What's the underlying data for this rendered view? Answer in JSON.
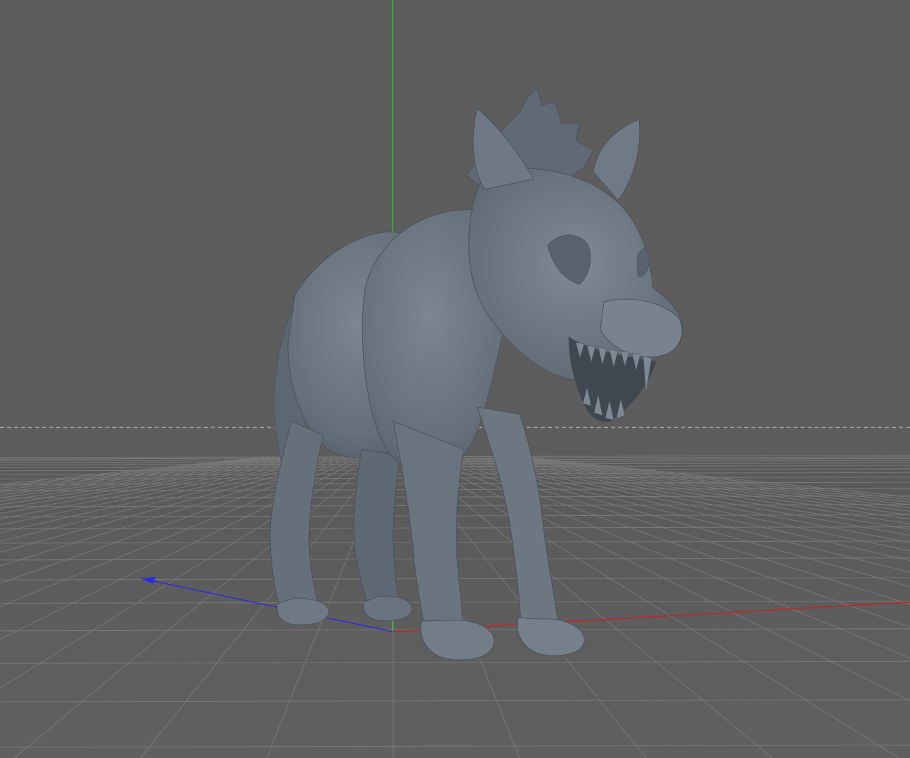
{
  "viewport": {
    "background": "#5c5c5c",
    "grid_color": "#7a7a7a",
    "horizon_line_color": "#b4b4b4",
    "y_axis_color": "#20d020",
    "x_axis_color": "#c02020",
    "z_axis_color": "#2a2ad0"
  },
  "model": {
    "name": "wolf",
    "shading": "#6a747e",
    "shadow": "#4a535c",
    "highlight": "#8893a0"
  }
}
